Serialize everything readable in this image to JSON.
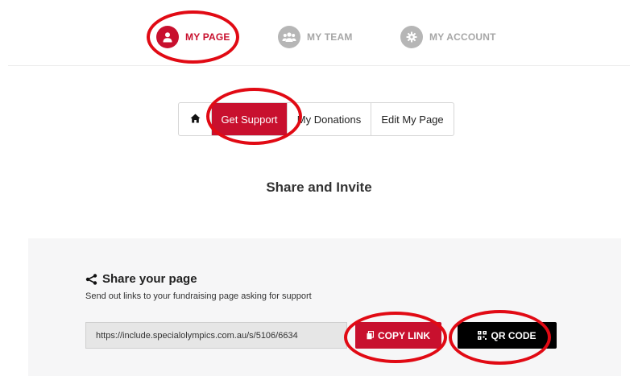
{
  "topnav": {
    "items": [
      {
        "label": "MY PAGE",
        "icon": "user-icon",
        "active": true
      },
      {
        "label": "MY TEAM",
        "icon": "team-icon",
        "active": false
      },
      {
        "label": "MY ACCOUNT",
        "icon": "gear-icon",
        "active": false
      }
    ]
  },
  "subtabs": {
    "home_icon": "home-icon",
    "items": [
      {
        "label": "Get Support",
        "active": true
      },
      {
        "label": "My Donations",
        "active": false
      },
      {
        "label": "Edit My Page",
        "active": false
      }
    ]
  },
  "main": {
    "title": "Share and Invite"
  },
  "share": {
    "heading": "Share your page",
    "description": "Send out links to your fundraising page asking for support",
    "link_value": "https://include.specialolympics.com.au/s/5106/6634",
    "copy_label": "COPY LINK",
    "qr_label": "QR CODE"
  },
  "colors": {
    "brand_red": "#c8102e",
    "annotation_red": "#e10a14",
    "inactive_gray": "#b6b6b6",
    "panel_bg": "#f6f6f7"
  }
}
